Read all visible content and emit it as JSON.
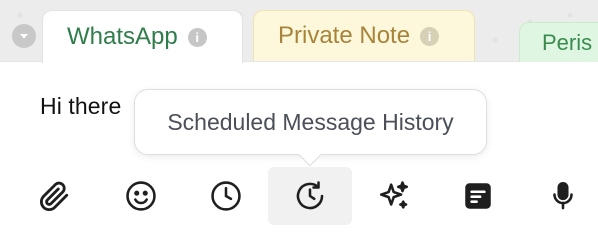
{
  "tabs": [
    {
      "label": "WhatsApp",
      "info_icon": "info-icon",
      "color": "#2e7d4a"
    },
    {
      "label": "Private Note",
      "info_icon": "info-icon",
      "color": "#a8843a"
    },
    {
      "label": "Peris",
      "color": "#3b8b4e"
    }
  ],
  "composer": {
    "message": "Hi there"
  },
  "tooltip": {
    "text": "Scheduled Message History"
  },
  "toolbar": [
    {
      "icon": "paperclip-icon"
    },
    {
      "icon": "emoji-icon"
    },
    {
      "icon": "clock-icon"
    },
    {
      "icon": "clock-history-icon",
      "active": true
    },
    {
      "icon": "sparkles-icon"
    },
    {
      "icon": "note-icon"
    },
    {
      "icon": "microphone-icon"
    }
  ]
}
